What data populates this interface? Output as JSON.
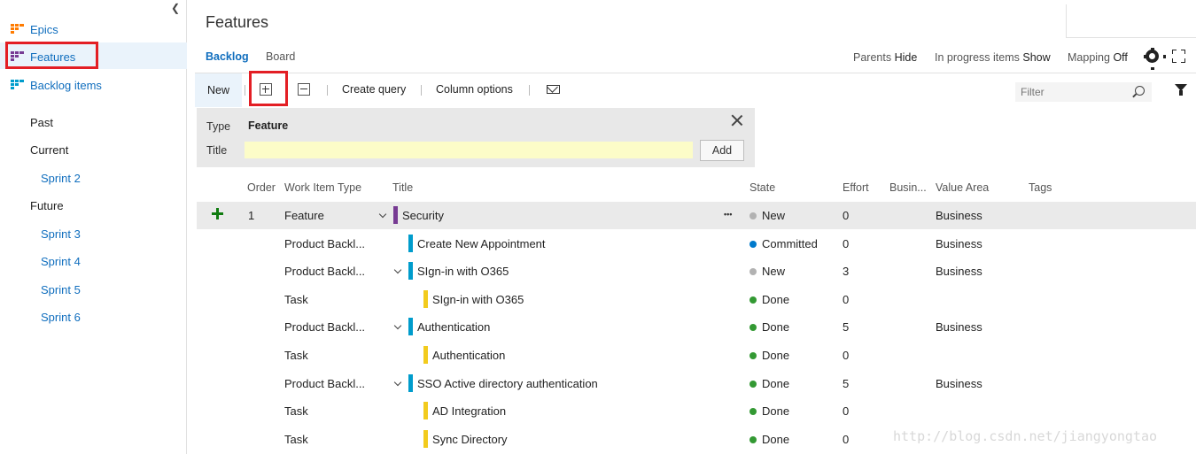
{
  "sidebar": {
    "items": [
      {
        "label": "Epics",
        "color": "#ff7b00"
      },
      {
        "label": "Features",
        "color": "#773b93"
      },
      {
        "label": "Backlog items",
        "color": "#009ccc"
      }
    ],
    "iterations": {
      "past": "Past",
      "current": "Current",
      "current_sprints": [
        "Sprint 2"
      ],
      "future": "Future",
      "future_sprints": [
        "Sprint 3",
        "Sprint 4",
        "Sprint 5",
        "Sprint 6"
      ]
    }
  },
  "header": {
    "title": "Features",
    "tabs": [
      {
        "label": "Backlog",
        "active": true
      },
      {
        "label": "Board",
        "active": false
      }
    ],
    "view_options": {
      "parents_label": "Parents",
      "parents_value": "Hide",
      "in_progress_label": "In progress items",
      "in_progress_value": "Show",
      "mapping_label": "Mapping",
      "mapping_value": "Off"
    }
  },
  "toolbar": {
    "new_label": "New",
    "create_query_label": "Create query",
    "column_options_label": "Column options",
    "filter_placeholder": "Filter"
  },
  "add_panel": {
    "type_label": "Type",
    "type_value": "Feature",
    "title_label": "Title",
    "title_value": "",
    "add_label": "Add"
  },
  "grid": {
    "columns": [
      "Order",
      "Work Item Type",
      "Title",
      "State",
      "Effort",
      "Busin...",
      "Value Area",
      "Tags"
    ],
    "rows": [
      {
        "order": "1",
        "type": "Feature",
        "title": "Security",
        "state": "New",
        "effort": "0",
        "business": "",
        "value_area": "Business",
        "tags": "",
        "level": 0,
        "expanded": true,
        "bar_color": "#773b93",
        "state_color": "#b2b2b2"
      },
      {
        "order": "",
        "type": "Product Backl...",
        "title": "Create New Appointment",
        "state": "Committed",
        "effort": "0",
        "business": "",
        "value_area": "Business",
        "tags": "",
        "level": 1,
        "expanded": false,
        "bar_color": "#009ccc",
        "state_color": "#007acc"
      },
      {
        "order": "",
        "type": "Product Backl...",
        "title": "SIgn-in with O365",
        "state": "New",
        "effort": "3",
        "business": "",
        "value_area": "Business",
        "tags": "",
        "level": 1,
        "expanded": true,
        "bar_color": "#009ccc",
        "state_color": "#b2b2b2"
      },
      {
        "order": "",
        "type": "Task",
        "title": "SIgn-in with O365",
        "state": "Done",
        "effort": "0",
        "business": "",
        "value_area": "",
        "tags": "",
        "level": 2,
        "expanded": false,
        "bar_color": "#f2cb1d",
        "state_color": "#339933"
      },
      {
        "order": "",
        "type": "Product Backl...",
        "title": "Authentication",
        "state": "Done",
        "effort": "5",
        "business": "",
        "value_area": "Business",
        "tags": "",
        "level": 1,
        "expanded": true,
        "bar_color": "#009ccc",
        "state_color": "#339933"
      },
      {
        "order": "",
        "type": "Task",
        "title": "Authentication",
        "state": "Done",
        "effort": "0",
        "business": "",
        "value_area": "",
        "tags": "",
        "level": 2,
        "expanded": false,
        "bar_color": "#f2cb1d",
        "state_color": "#339933"
      },
      {
        "order": "",
        "type": "Product Backl...",
        "title": "SSO Active directory authentication",
        "state": "Done",
        "effort": "5",
        "business": "",
        "value_area": "Business",
        "tags": "",
        "level": 1,
        "expanded": true,
        "bar_color": "#009ccc",
        "state_color": "#339933"
      },
      {
        "order": "",
        "type": "Task",
        "title": "AD Integration",
        "state": "Done",
        "effort": "0",
        "business": "",
        "value_area": "",
        "tags": "",
        "level": 2,
        "expanded": false,
        "bar_color": "#f2cb1d",
        "state_color": "#339933"
      },
      {
        "order": "",
        "type": "Task",
        "title": "Sync Directory",
        "state": "Done",
        "effort": "0",
        "business": "",
        "value_area": "",
        "tags": "",
        "level": 2,
        "expanded": false,
        "bar_color": "#f2cb1d",
        "state_color": "#339933"
      }
    ]
  },
  "watermark": "http://blog.csdn.net/jiangyongtao"
}
